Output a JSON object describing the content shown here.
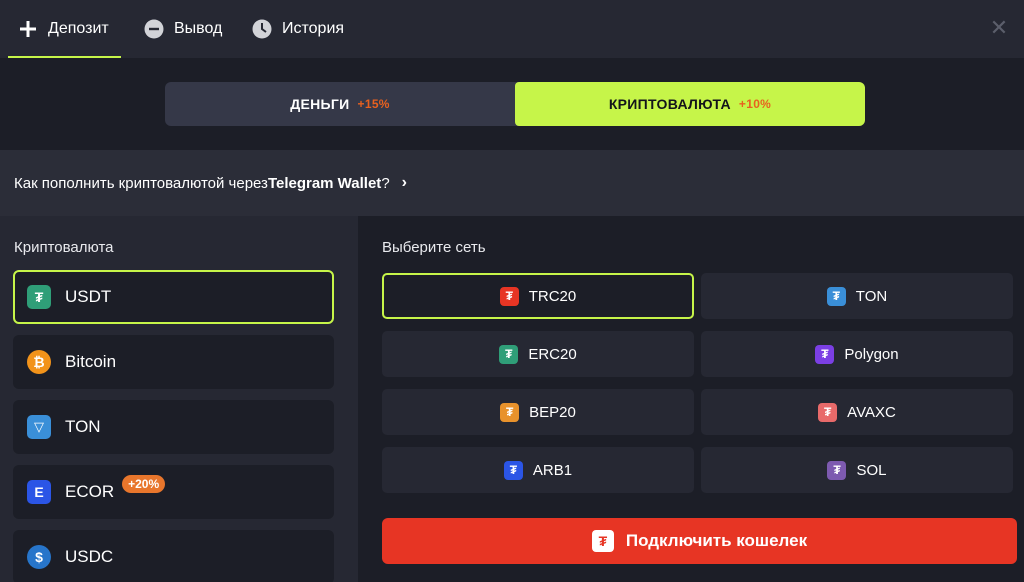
{
  "tabs": [
    {
      "label": "Депозит",
      "icon": "plus-icon",
      "active": true
    },
    {
      "label": "Вывод",
      "icon": "minus-circle-icon",
      "active": false
    },
    {
      "label": "История",
      "icon": "clock-icon",
      "active": false
    }
  ],
  "close_symbol": "✕",
  "segments": [
    {
      "label": "ДЕНЬГИ",
      "bonus": "+15%",
      "active": false
    },
    {
      "label": "КРИПТОВАЛЮТА",
      "bonus": "+10%",
      "active": true
    }
  ],
  "banner": {
    "text_before": "Как пополнить криптовалютой через ",
    "text_bold": "Telegram Wallet",
    "text_after": "?",
    "chevron": "›"
  },
  "crypto": {
    "title": "Криптовалюта",
    "items": [
      {
        "label": "USDT",
        "icon": "tether-icon",
        "glyph": "₮",
        "color": "#2f9e78",
        "active": true
      },
      {
        "label": "Bitcoin",
        "icon": "bitcoin-icon",
        "glyph": "₿",
        "color": "#f2931a",
        "active": false
      },
      {
        "label": "TON",
        "icon": "ton-icon",
        "glyph": "▽",
        "color": "#3a8fd8",
        "active": false
      },
      {
        "label": "ECOR",
        "icon": "ecor-icon",
        "glyph": "E",
        "color": "#2b55e6",
        "active": false,
        "promo": "+20%"
      },
      {
        "label": "USDC",
        "icon": "usdc-icon",
        "glyph": "$",
        "color": "#2775ca",
        "active": false
      }
    ]
  },
  "network": {
    "title": "Выберите сеть",
    "items": [
      {
        "label": "TRC20",
        "icon": "trc20-icon",
        "glyph": "₮",
        "color": "#e73524",
        "active": true
      },
      {
        "label": "TON",
        "icon": "ton-network-icon",
        "glyph": "₮",
        "color": "#3a8fd8",
        "active": false
      },
      {
        "label": "ERC20",
        "icon": "erc20-icon",
        "glyph": "₮",
        "color": "#2f9e78",
        "active": false
      },
      {
        "label": "Polygon",
        "icon": "polygon-icon",
        "glyph": "₮",
        "color": "#7b3fe4",
        "active": false
      },
      {
        "label": "BEP20",
        "icon": "bep20-icon",
        "glyph": "₮",
        "color": "#e8922c",
        "active": false
      },
      {
        "label": "AVAXC",
        "icon": "avaxc-icon",
        "glyph": "₮",
        "color": "#e86a6a",
        "active": false
      },
      {
        "label": "ARB1",
        "icon": "arb1-icon",
        "glyph": "₮",
        "color": "#2b55e6",
        "active": false
      },
      {
        "label": "SOL",
        "icon": "sol-icon",
        "glyph": "₮",
        "color": "#7d5ab0",
        "active": false
      }
    ]
  },
  "connect_button": {
    "label": "Подключить кошелек",
    "glyph": "₮"
  },
  "colors": {
    "accent": "#c6f549",
    "primary_red": "#e73524",
    "bonus_orange": "#e8611f"
  }
}
